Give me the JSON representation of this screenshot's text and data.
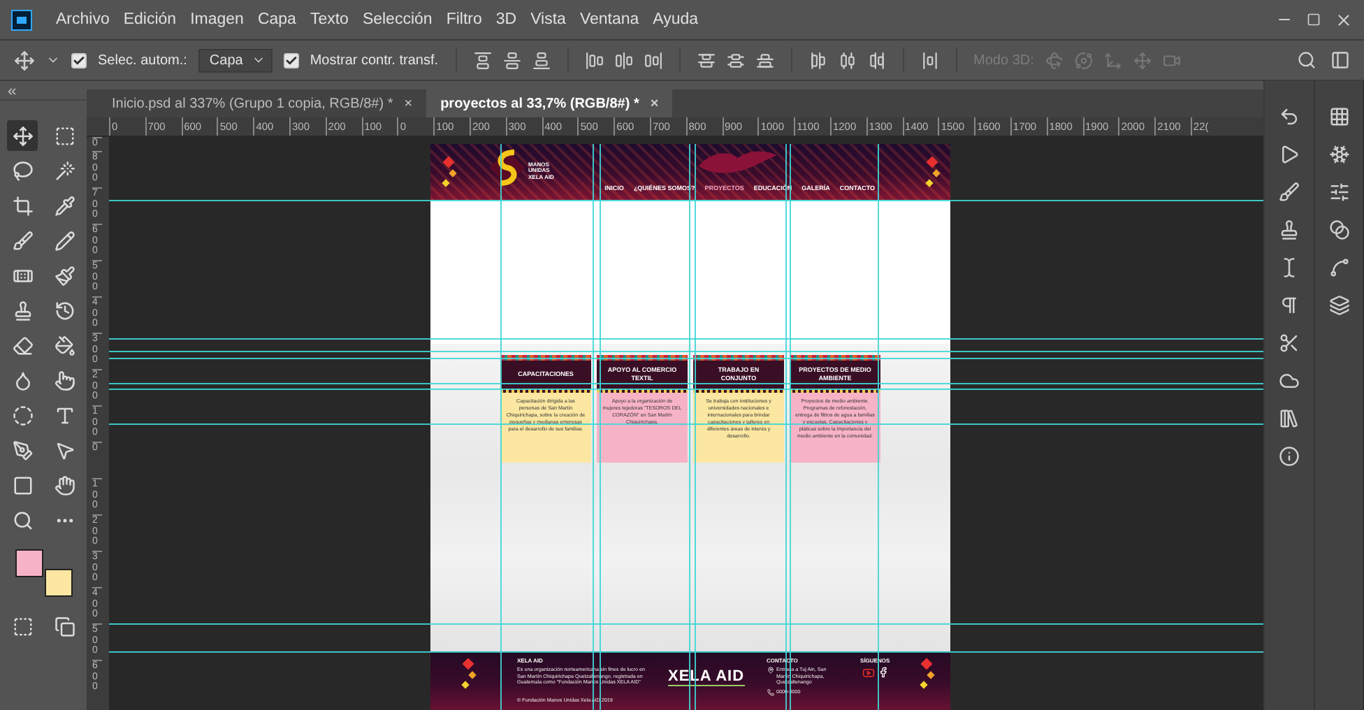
{
  "menu": {
    "items": [
      "Archivo",
      "Edición",
      "Imagen",
      "Capa",
      "Texto",
      "Selección",
      "Filtro",
      "3D",
      "Vista",
      "Ventana",
      "Ayuda"
    ]
  },
  "options_bar": {
    "auto_select": {
      "label": "Selec. autom.:",
      "checked": true
    },
    "target": {
      "value": "Capa"
    },
    "show_transform": {
      "label": "Mostrar contr. transf.",
      "checked": true
    },
    "mode_3d": {
      "label": "Modo 3D:",
      "disabled": true
    }
  },
  "tabs": [
    {
      "label": "Inicio.psd al 337% (Grupo 1 copia, RGB/8#) *",
      "close": "×",
      "selected": false
    },
    {
      "label": "proyectos al 33,7% (RGB/8#) *",
      "close": "×",
      "selected": true
    }
  ],
  "rulers": {
    "horizontal": [
      "0",
      "700",
      "600",
      "500",
      "400",
      "300",
      "200",
      "100",
      "0",
      "100",
      "200",
      "300",
      "400",
      "500",
      "600",
      "700",
      "800",
      "900",
      "1000",
      "1100",
      "1200",
      "1300",
      "1400",
      "1500",
      "1600",
      "1700",
      "1800",
      "1900",
      "2000",
      "2100",
      "22("
    ],
    "vertical": [
      "0",
      "800",
      "700",
      "600",
      "500",
      "400",
      "300",
      "200",
      "100",
      "0",
      "100",
      "200",
      "300",
      "400",
      "500",
      "600"
    ]
  },
  "tools": [
    {
      "selected": true
    },
    {
      "selected": false
    },
    {
      "selected": false
    },
    {
      "selected": false
    },
    {
      "selected": false
    },
    {
      "selected": false
    },
    {
      "selected": false
    },
    {
      "selected": false
    },
    {
      "selected": false
    },
    {
      "selected": false
    },
    {
      "selected": false
    },
    {
      "selected": false
    },
    {
      "selected": false
    },
    {
      "selected": false
    },
    {
      "selected": false
    },
    {
      "selected": false
    },
    {
      "selected": false
    },
    {
      "selected": false
    },
    {
      "selected": false
    },
    {
      "selected": false
    },
    {
      "selected": false
    },
    {
      "selected": false
    },
    {
      "selected": false
    },
    {
      "selected": false
    },
    {
      "selected": false
    },
    {
      "selected": false
    }
  ],
  "swatches": [
    {
      "kind": "foreground",
      "color": "#f7b3c6"
    },
    {
      "kind": "background",
      "color": "#fbe7a1"
    }
  ],
  "document": {
    "logo_text": "MANOS UNIDAS XELA AID",
    "nav": [
      {
        "label": "INICIO",
        "selected": false
      },
      {
        "label": "¿QUIÉNES SOMOS?",
        "selected": false
      },
      {
        "label": "PROYECTOS",
        "selected": true
      },
      {
        "label": "EDUCACIÓN",
        "selected": false
      },
      {
        "label": "GALERÍA",
        "selected": false
      },
      {
        "label": "CONTACTO",
        "selected": false
      }
    ],
    "cards": [
      {
        "title": "CAPACITACIONES",
        "text": "Capacitación dirigida a las personas de San Martín Chiquirichapa, sobre la creación de pequeñas y medianas empresas para el desarrollo de sus familias.",
        "color": "#fbe7a1"
      },
      {
        "title": "APOYO AL COMERCIO TEXTIL",
        "text": "Apoyo a la organización de mujeres tejedoras \"TESOROS DEL CORAZÓN\" en San Martín Chiquirichapa.",
        "color": "#f7b3c6"
      },
      {
        "title": "TRABAJO EN CONJUNTO",
        "text": "Se trabaja con instituciones y universidades nacionales e internacionales para brindar capacitaciones y talleres en diferentes áreas de interés y desarrollo.",
        "color": "#fbe7a1"
      },
      {
        "title": "PROYECTOS DE MEDIO AMBIENTE",
        "text": "Proyectos de medio ambiente. Programas de reforestación, entrega de filtros de agua a familias y escuelas. Capacitaciones y pláticas sobre la importancia del medio ambiente en la comunidad.",
        "color": "#f7b3c6"
      }
    ],
    "footer": {
      "org_title": "XELA AID",
      "org_text": "Es una organización norteamericana sin fines de lucro en San Martín Chiquirichapa Quetzaltenango, registrada en Guatemala como \"Fundación Manos Unidas XELA AID\"",
      "copyright": "© Fundación Manos Unidas Xela AID 2019",
      "logo": "XELA AID",
      "contact_title": "CONTACTO",
      "address": "Entrada a Tuj Ain, San Martín Chiquirichapa, Quetzaltenango",
      "phone": "0000-0000",
      "social_title": "SÍGUENOS"
    }
  }
}
